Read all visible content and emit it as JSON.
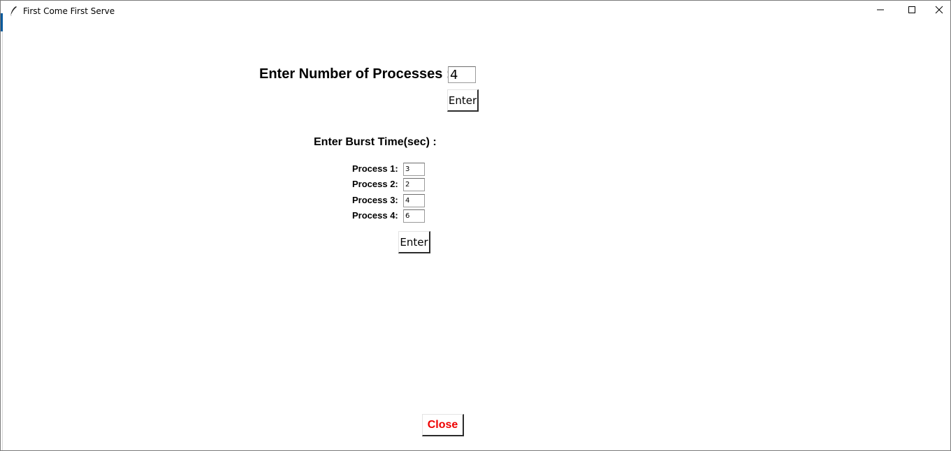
{
  "window": {
    "title": "First Come First Serve",
    "icon": "feather-icon",
    "controls": [
      "minimize-icon",
      "maximize-icon",
      "close-icon"
    ]
  },
  "main": {
    "num_processes_label": "Enter Number of Processes :",
    "num_processes_value": "4",
    "enter_button_label": "Enter",
    "burst_time_label": "Enter Burst Time(sec) :",
    "processes": [
      {
        "label": "Process 1:",
        "value": "3"
      },
      {
        "label": "Process 2:",
        "value": "2"
      },
      {
        "label": "Process 3:",
        "value": "4"
      },
      {
        "label": "Process 4:",
        "value": "6"
      }
    ],
    "burst_enter_button_label": "Enter",
    "close_button_label": "Close"
  },
  "colors": {
    "close_text": "#ee0000",
    "accent": "#0a5a9c"
  }
}
